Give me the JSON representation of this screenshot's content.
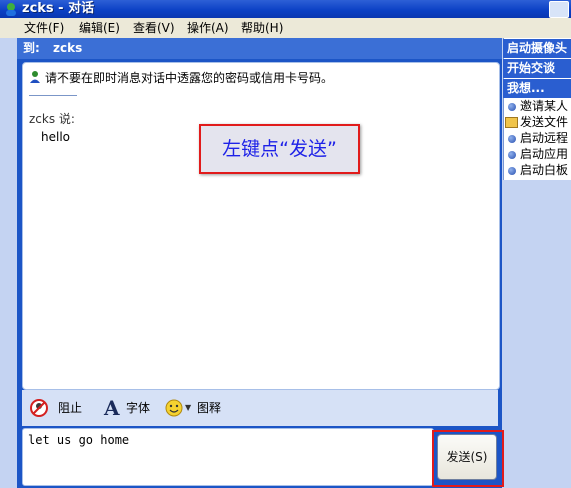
{
  "window": {
    "title": "zcks - 对话"
  },
  "menu": [
    {
      "label": "文件(F)"
    },
    {
      "label": "编辑(E)"
    },
    {
      "label": "查看(V)"
    },
    {
      "label": "操作(A)"
    },
    {
      "label": "帮助(H)"
    }
  ],
  "conversation": {
    "to_label": "到:",
    "to_value": "zcks",
    "warning": "请不要在即时消息对话中透露您的密码或信用卡号码。",
    "sender_line": "zcks 说:",
    "message": "hello"
  },
  "callout": {
    "text": "左键点“发送”"
  },
  "toolbar": {
    "block_label": "阻止",
    "font_label": "字体",
    "emoticon_label": "图释"
  },
  "compose": {
    "text": "let us go home"
  },
  "send": {
    "label": "发送(S)"
  },
  "right_panel": {
    "headers": [
      "启动摄像头",
      "开始交谈",
      "我想..."
    ],
    "items": [
      "邀请某人",
      "发送文件",
      "启动远程",
      "启动应用",
      "启动白板"
    ]
  },
  "colors": {
    "accent": "#1c55c6",
    "highlight": "#e11b1b",
    "callout_text": "#1e22e8"
  }
}
